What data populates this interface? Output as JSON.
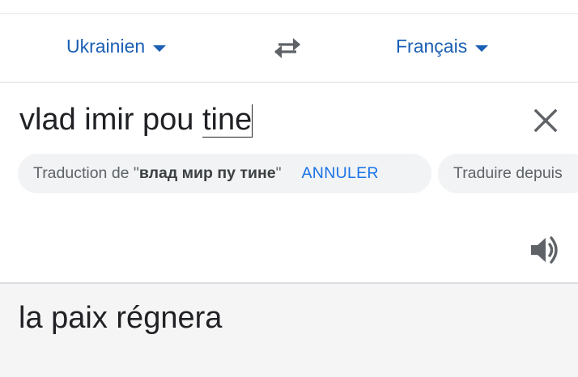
{
  "languages": {
    "source": "Ukrainien",
    "target": "Français"
  },
  "input": {
    "text_plain": "vlad imir pou ",
    "text_underlined": "tine"
  },
  "suggestion": {
    "prefix": "Traduction de \"",
    "bold_text": "влад мир пу тине",
    "suffix": "\"",
    "cancel_label": "ANNULER",
    "next_chip_label": "Traduire depuis"
  },
  "output": {
    "text": "la paix régnera"
  },
  "icons": {
    "swap": "swap-arrows-icon",
    "clear": "close-icon",
    "speaker": "speaker-icon",
    "caret": "caret-down-icon"
  },
  "colors": {
    "accent": "#1a73e8",
    "text": "#202124",
    "muted": "#5f6368",
    "chip_bg": "#f1f3f4",
    "output_bg": "#f5f5f5"
  }
}
